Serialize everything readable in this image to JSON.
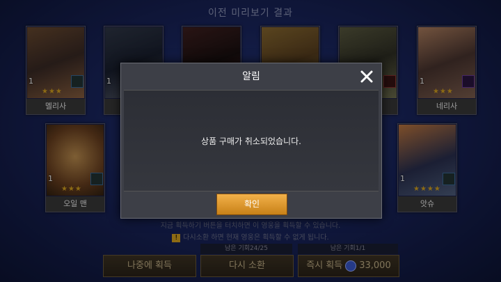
{
  "header": {
    "title": "이전 미리보기 결과"
  },
  "cards": [
    {
      "name": "멜리사",
      "level": "1",
      "stars": "★★★",
      "cls": "normal"
    },
    {
      "name": "",
      "level": "1",
      "stars": "",
      "cls": "normal"
    },
    {
      "name": "",
      "level": "",
      "stars": "",
      "cls": "normal"
    },
    {
      "name": "",
      "level": "",
      "stars": "",
      "cls": "normal"
    },
    {
      "name": "",
      "level": "",
      "stars": "",
      "cls": "red"
    },
    {
      "name": "네리사",
      "level": "1",
      "stars": "★★★",
      "cls": "purple"
    },
    {
      "name": "오일 맨",
      "level": "1",
      "stars": "★★★",
      "cls": "normal"
    },
    {
      "name": "앗슈",
      "level": "1",
      "stars": "★★★★",
      "cls": "normal"
    }
  ],
  "modal": {
    "title": "알림",
    "message": "상품 구매가 취소되었습니다.",
    "confirm_label": "확인"
  },
  "notices": {
    "line1": "지금 획득하기 버튼을 터치하면 이 영웅을 획득할 수 있습니다.",
    "line2": "다시소환 하면 현재 영웅은 획득할 수 없게 됩니다."
  },
  "bottom": {
    "later_label": "나중에 획득",
    "resummon_label": "다시 소환",
    "resummon_caption": "남은 기회24/25",
    "instant_label": "즉시 획득",
    "instant_caption": "남은 기회1/1",
    "instant_price": "33,000"
  },
  "colors": {
    "accent": "#d9a520",
    "confirm": "#e09a30",
    "bg": "#1a2660"
  }
}
